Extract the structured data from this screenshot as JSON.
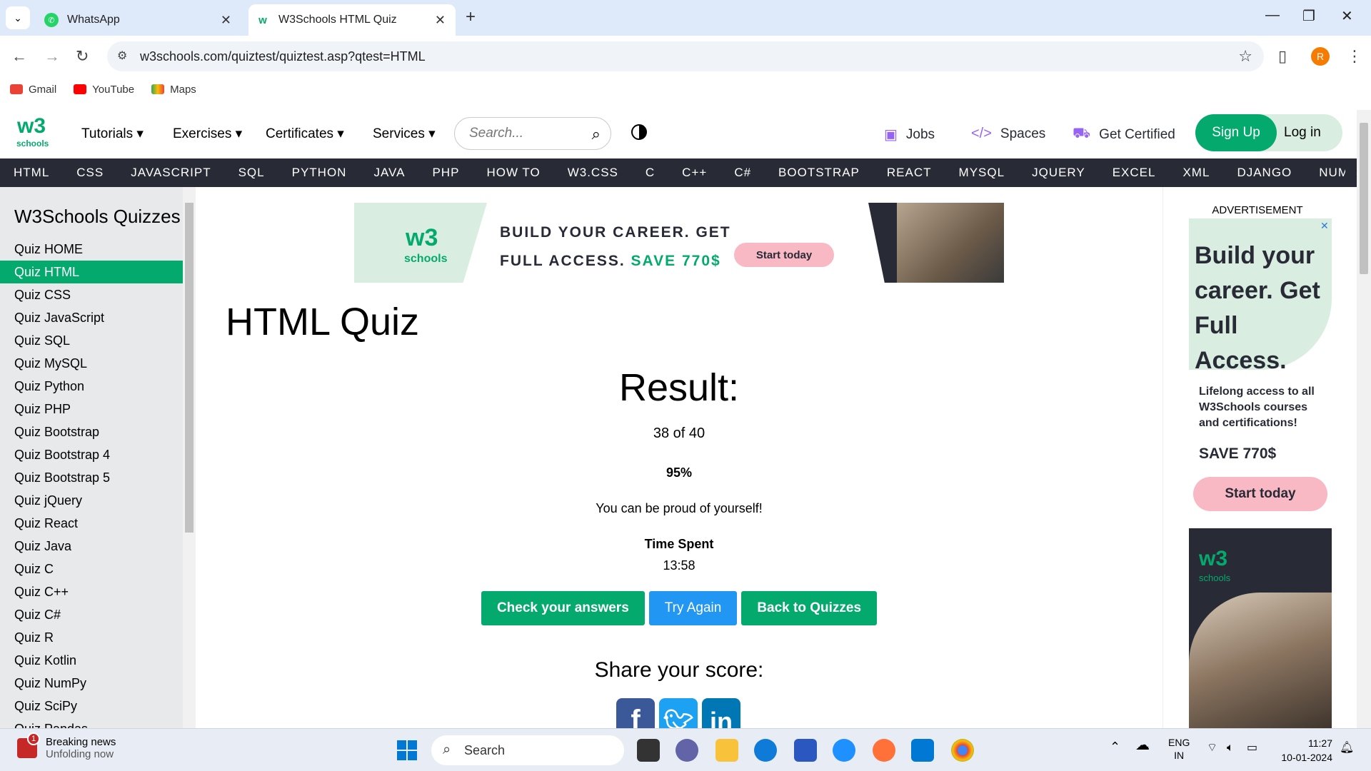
{
  "browser": {
    "tabs": [
      {
        "title": "WhatsApp",
        "active": false
      },
      {
        "title": "W3Schools HTML Quiz",
        "active": true
      }
    ],
    "url": "w3schools.com/quiztest/quiztest.asp?qtest=HTML",
    "profile_initial": "R",
    "bookmarks": [
      "Gmail",
      "YouTube",
      "Maps"
    ]
  },
  "header": {
    "logo_text": "w3",
    "logo_sub": "schools",
    "menus": [
      "Tutorials",
      "Exercises",
      "Certificates",
      "Services"
    ],
    "search_placeholder": "Search...",
    "right_links": [
      "Jobs",
      "Spaces",
      "Get Certified"
    ],
    "signup": "Sign Up",
    "login": "Log in"
  },
  "topnav": [
    "HTML",
    "CSS",
    "JAVASCRIPT",
    "SQL",
    "PYTHON",
    "JAVA",
    "PHP",
    "HOW TO",
    "W3.CSS",
    "C",
    "C++",
    "C#",
    "BOOTSTRAP",
    "REACT",
    "MYSQL",
    "JQUERY",
    "EXCEL",
    "XML",
    "DJANGO",
    "NUMPY"
  ],
  "sidebar": {
    "title": "W3Schools Quizzes",
    "items": [
      "Quiz HOME",
      "Quiz HTML",
      "Quiz CSS",
      "Quiz JavaScript",
      "Quiz SQL",
      "Quiz MySQL",
      "Quiz Python",
      "Quiz PHP",
      "Quiz Bootstrap",
      "Quiz Bootstrap 4",
      "Quiz Bootstrap 5",
      "Quiz jQuery",
      "Quiz React",
      "Quiz Java",
      "Quiz C",
      "Quiz C++",
      "Quiz C#",
      "Quiz R",
      "Quiz Kotlin",
      "Quiz NumPy",
      "Quiz SciPy",
      "Quiz Pandas"
    ],
    "active_index": 1
  },
  "banner_ad": {
    "line1": "BUILD YOUR CAREER. GET",
    "line2": "FULL ACCESS.",
    "save": "SAVE 770$",
    "button": "Start today",
    "logo": "w3",
    "logo_sub": "schools"
  },
  "quiz": {
    "title": "HTML Quiz",
    "result_heading": "Result:",
    "score": "38 of 40",
    "percent": "95%",
    "message": "You can be proud of yourself!",
    "time_label": "Time Spent",
    "time_value": "13:58",
    "buttons": [
      "Check your answers",
      "Try Again",
      "Back to Quizzes"
    ],
    "share_heading": "Share your score:"
  },
  "right_ad": {
    "label": "ADVERTISEMENT",
    "heading_lines": [
      "Build your",
      "career. Get",
      "Full Access."
    ],
    "body": "Lifelong access to all W3Schools courses and certifications!",
    "save": "SAVE 770$",
    "button": "Start today",
    "logo": "w3",
    "logo_sub": "schools"
  },
  "taskbar": {
    "news_title": "Breaking news",
    "news_sub": "Unfolding now",
    "news_badge": "1",
    "search": "Search",
    "lang1": "ENG",
    "lang2": "IN",
    "time": "11:27",
    "date": "10-01-2024"
  },
  "colors": {
    "brand_green": "#04aa6d",
    "topnav_bg": "#282a35",
    "blue_button": "#2196f3"
  }
}
